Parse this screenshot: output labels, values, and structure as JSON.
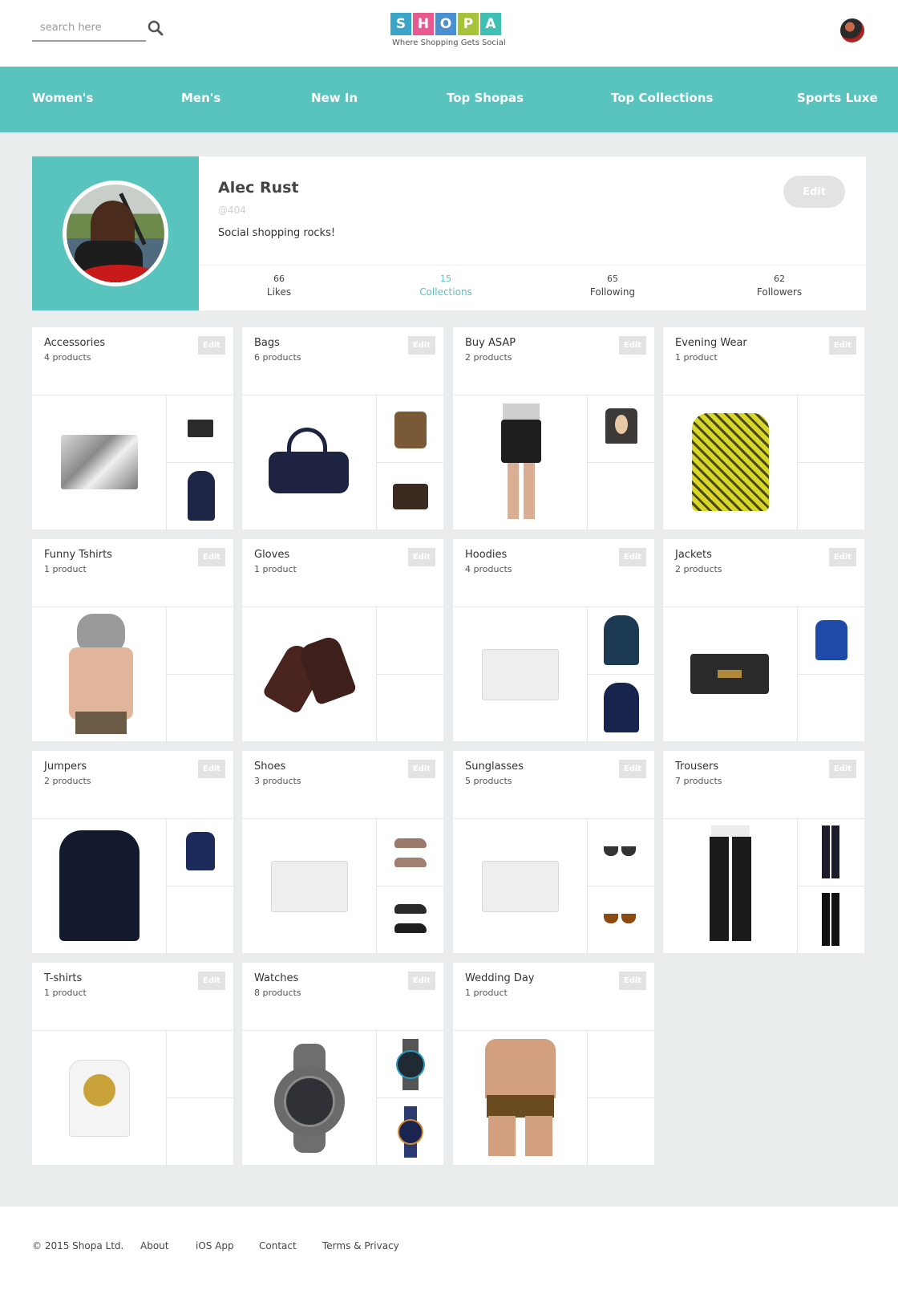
{
  "header": {
    "search_placeholder": "search here",
    "logo_letters": [
      "S",
      "H",
      "O",
      "P",
      "A"
    ],
    "logo_colors": [
      "#3aa5c9",
      "#e85a8f",
      "#4a8fd0",
      "#a7c33a",
      "#3fc0b2"
    ],
    "tagline": "Where Shopping Gets Social"
  },
  "nav": {
    "items": [
      "Women's",
      "Men's",
      "New In",
      "Top Shopas",
      "Top Collections",
      "Sports Luxe"
    ]
  },
  "profile": {
    "name": "Alec Rust",
    "handle": "@404",
    "bio": "Social shopping rocks!",
    "edit_label": "Edit",
    "stats": [
      {
        "value": "66",
        "label": "Likes"
      },
      {
        "value": "15",
        "label": "Collections"
      },
      {
        "value": "65",
        "label": "Following"
      },
      {
        "value": "62",
        "label": "Followers"
      }
    ]
  },
  "collections": [
    {
      "title": "Accessories",
      "count": "4 products",
      "edit": "Edit"
    },
    {
      "title": "Bags",
      "count": "6 products",
      "edit": "Edit"
    },
    {
      "title": "Buy ASAP",
      "count": "2 products",
      "edit": "Edit"
    },
    {
      "title": "Evening Wear",
      "count": "1 product",
      "edit": "Edit"
    },
    {
      "title": "Funny Tshirts",
      "count": "1 product",
      "edit": "Edit"
    },
    {
      "title": "Gloves",
      "count": "1 product",
      "edit": "Edit"
    },
    {
      "title": "Hoodies",
      "count": "4 products",
      "edit": "Edit"
    },
    {
      "title": "Jackets",
      "count": "2 products",
      "edit": "Edit"
    },
    {
      "title": "Jumpers",
      "count": "2 products",
      "edit": "Edit"
    },
    {
      "title": "Shoes",
      "count": "3 products",
      "edit": "Edit"
    },
    {
      "title": "Sunglasses",
      "count": "5 products",
      "edit": "Edit"
    },
    {
      "title": "Trousers",
      "count": "7 products",
      "edit": "Edit"
    },
    {
      "title": "T-shirts",
      "count": "1 product",
      "edit": "Edit"
    },
    {
      "title": "Watches",
      "count": "8 products",
      "edit": "Edit"
    },
    {
      "title": "Wedding Day",
      "count": "1 product",
      "edit": "Edit"
    }
  ],
  "footer": {
    "copyright": "© 2015 Shopa Ltd.",
    "links": [
      "About",
      "iOS App",
      "Contact",
      "Terms & Privacy"
    ]
  },
  "colors": {
    "accent": "#58c4bd",
    "page_bg": "#e9eded"
  }
}
